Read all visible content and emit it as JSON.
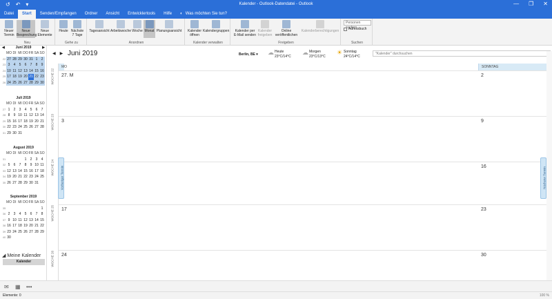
{
  "titlebar": {
    "title": "Kalender - Outlook-Datendatei - Outlook",
    "quick_access": [
      "↺",
      "↶",
      "▾"
    ],
    "window_buttons": [
      "—",
      "❐",
      "✕"
    ]
  },
  "tabs": [
    "Datei",
    "Start",
    "Senden/Empfangen",
    "Ordner",
    "Ansicht",
    "Entwicklertools",
    "Hilfe"
  ],
  "tell_me": "Was möchten Sie tun?",
  "ribbon": {
    "neu": {
      "label": "Neu",
      "buttons": [
        "Neuer Termin",
        "Neue Besprechung",
        "Neue Elemente"
      ]
    },
    "gehezu": {
      "label": "Gehe zu",
      "buttons": [
        "Heute",
        "Nächste 7 Tage"
      ]
    },
    "anordnen": {
      "label": "Anordnen",
      "buttons": [
        "Tagesansicht",
        "Arbeitswoche",
        "Woche",
        "Monat",
        "Planungsansicht"
      ]
    },
    "verwalten": {
      "label": "Kalender verwalten",
      "buttons": [
        "Kalender öffnen",
        "Kalendergruppen"
      ]
    },
    "freigeben": {
      "label": "Freigeben",
      "buttons": [
        "Kalender per E-Mail senden",
        "Kalender freigeben",
        "Online veröffentlichen",
        "Kalenderberechtigungen"
      ]
    },
    "suchen": {
      "label": "Suchen",
      "search_placeholder": "Personen suchen",
      "adressbuch": "Adressbuch"
    }
  },
  "minicals": [
    {
      "title": "Juni 2019",
      "days": [
        "MO",
        "DI",
        "MI",
        "DO",
        "FR",
        "SA",
        "SO"
      ],
      "weeks": [
        {
          "wk": "22",
          "d": [
            "27",
            "28",
            "29",
            "30",
            "31",
            "1",
            "2"
          ]
        },
        {
          "wk": "23",
          "d": [
            "3",
            "4",
            "5",
            "6",
            "7",
            "8",
            "9"
          ]
        },
        {
          "wk": "24",
          "d": [
            "10",
            "11",
            "12",
            "13",
            "14",
            "15",
            "16"
          ]
        },
        {
          "wk": "25",
          "d": [
            "17",
            "18",
            "19",
            "20",
            "21",
            "22",
            "23"
          ]
        },
        {
          "wk": "26",
          "d": [
            "24",
            "25",
            "26",
            "27",
            "28",
            "29",
            "30"
          ]
        }
      ]
    },
    {
      "title": "Juli 2019",
      "days": [
        "MO",
        "DI",
        "MI",
        "DO",
        "FR",
        "SA",
        "SO"
      ],
      "weeks": [
        {
          "wk": "27",
          "d": [
            "1",
            "2",
            "3",
            "4",
            "5",
            "6",
            "7"
          ]
        },
        {
          "wk": "28",
          "d": [
            "8",
            "9",
            "10",
            "11",
            "12",
            "13",
            "14"
          ]
        },
        {
          "wk": "29",
          "d": [
            "15",
            "16",
            "17",
            "18",
            "19",
            "20",
            "21"
          ]
        },
        {
          "wk": "30",
          "d": [
            "22",
            "23",
            "24",
            "25",
            "26",
            "27",
            "28"
          ]
        },
        {
          "wk": "31",
          "d": [
            "29",
            "30",
            "31",
            "",
            "",
            "",
            ""
          ]
        }
      ]
    },
    {
      "title": "August 2019",
      "days": [
        "MO",
        "DI",
        "MI",
        "DO",
        "FR",
        "SA",
        "SO"
      ],
      "weeks": [
        {
          "wk": "31",
          "d": [
            "",
            "",
            "",
            "1",
            "2",
            "3",
            "4"
          ]
        },
        {
          "wk": "32",
          "d": [
            "5",
            "6",
            "7",
            "8",
            "9",
            "10",
            "11"
          ]
        },
        {
          "wk": "33",
          "d": [
            "12",
            "13",
            "14",
            "15",
            "16",
            "17",
            "18"
          ]
        },
        {
          "wk": "34",
          "d": [
            "19",
            "20",
            "21",
            "22",
            "23",
            "24",
            "25"
          ]
        },
        {
          "wk": "35",
          "d": [
            "26",
            "27",
            "28",
            "29",
            "30",
            "31",
            ""
          ]
        }
      ]
    },
    {
      "title": "September 2019",
      "days": [
        "MO",
        "DI",
        "MI",
        "DO",
        "FR",
        "SA",
        "SO"
      ],
      "weeks": [
        {
          "wk": "35",
          "d": [
            "",
            "",
            "",
            "",
            "",
            "",
            "1"
          ]
        },
        {
          "wk": "36",
          "d": [
            "2",
            "3",
            "4",
            "5",
            "6",
            "7",
            "8"
          ]
        },
        {
          "wk": "37",
          "d": [
            "9",
            "10",
            "11",
            "12",
            "13",
            "14",
            "15"
          ]
        },
        {
          "wk": "38",
          "d": [
            "16",
            "17",
            "18",
            "19",
            "20",
            "21",
            "22"
          ]
        },
        {
          "wk": "39",
          "d": [
            "23",
            "24",
            "25",
            "26",
            "27",
            "28",
            "29"
          ]
        },
        {
          "wk": "40",
          "d": [
            "30",
            "",
            "",
            "",
            "",
            "",
            ""
          ]
        }
      ]
    }
  ],
  "today": "21",
  "my_calendars": "Meine Kalender",
  "calendar_item": "Kalender",
  "nav_icons": [
    "✉",
    "▦",
    "•••"
  ],
  "status": {
    "items": "Elemente: 0",
    "zoom": "100 %"
  },
  "calview": {
    "month_title": "Juni 2019",
    "location": "Berlin, BE",
    "weather": [
      {
        "label": "Heute",
        "temp": "23°C/14°C",
        "icon": "cloud-sun"
      },
      {
        "label": "Morgen",
        "temp": "23°C/13°C",
        "icon": "cloud-sun"
      },
      {
        "label": "Sonntag",
        "temp": "24°C/14°C",
        "icon": "sun"
      }
    ],
    "search_placeholder": "\"Kalender\" durchsuchen",
    "col_left": "MO",
    "col_right": "SONNTAG",
    "weeks": [
      {
        "label": "WOCHE 22",
        "left": "27. M",
        "right": "2"
      },
      {
        "label": "WOCHE 23",
        "left": "3",
        "right": "9"
      },
      {
        "label": "WOCHE 24",
        "left": "",
        "right": "16"
      },
      {
        "label": "WOCHE 25",
        "left": "17",
        "right": "23"
      },
      {
        "label": "WOCHE 26",
        "left": "24",
        "right": "30"
      }
    ],
    "prev_appt": "Vorheriger Termin",
    "next_appt": "Nächster Termin"
  }
}
